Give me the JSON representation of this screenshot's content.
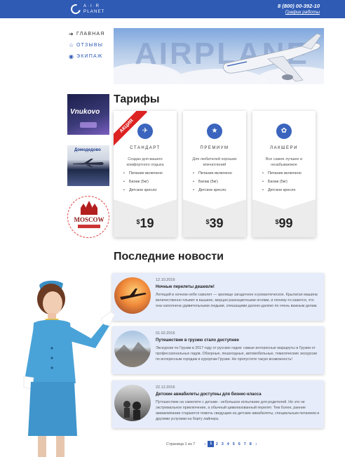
{
  "header": {
    "logo_line1": "A·I·R",
    "logo_line2": "PLANET",
    "phone": "8 (800) 00-392-10",
    "hours": "График работы"
  },
  "nav": [
    {
      "label": "ГЛАВНАЯ",
      "icon": "arrow-right-icon",
      "active": true
    },
    {
      "label": "ОТЗЫВЫ",
      "icon": "star-outline-icon",
      "active": false
    },
    {
      "label": "ЭКИПАЖ",
      "icon": "eye-icon",
      "active": false
    }
  ],
  "hero": {
    "text": "AIRPLANE"
  },
  "ads": {
    "vnukovo": "Vnukovo",
    "domodedovo": "Домодедово",
    "moscow": "MOSCOW"
  },
  "tariffs": {
    "title": "Тарифы",
    "ribbon": "АКЦИЯ",
    "items": [
      {
        "name": "СТАНДАРТ",
        "desc": "Создан для вашего комфортного отдыха",
        "features": [
          "Питание включено",
          "Багаж (5кг)",
          "Детское кресло"
        ],
        "price": "19",
        "currency": "$",
        "icon": "plane-icon"
      },
      {
        "name": "ПРЕМИУМ",
        "desc": "Для любителей хороших впечатлений",
        "features": [
          "Питание включено",
          "Багаж (5кг)",
          "Детское кресло"
        ],
        "price": "39",
        "currency": "$",
        "icon": "star-icon"
      },
      {
        "name": "ЛАКШЕРИ",
        "desc": "Все самое лучшее и незабываемое",
        "features": [
          "Питание включено",
          "Багаж (5кг)",
          "Детское кресло"
        ],
        "price": "99",
        "currency": "$",
        "icon": "palette-icon"
      }
    ]
  },
  "news": {
    "title": "Последние новости",
    "items": [
      {
        "date": "12.10.2016",
        "title": "Ночные перелеты дешевле!",
        "text": "Летящий в ночном небе самолет — зрелище загадочное и романтическое. Крылатая машина величественно плывет в вышине, мерцая разноцветными огнями, и почему-то кажется, что она наполнена удивительными людьми, спешащими далеко-далеко по очень важным делам."
      },
      {
        "date": "01.02.2016",
        "title": "Путешествие в грузию стало доступнее",
        "text": "Экскурсии по Грузии в 2017 году от русских гидов: самые интересные маршруты в Грузии от профессиональных гидов. Обзорные, пешеходные, автомобильные, тематические экскурсии по интересным городам и курортам Грузии. Не пропустите такую возможность!"
      },
      {
        "date": "22.12.2016",
        "title": "Детские авиабилеты доступны для бизнес-класса",
        "text": "Путешествие на самолете с детьми - небольшое испытание для родителей. Но это не экстремальное приключение, а обычный цивилизованный перелет. Тем более, ранние авиакомпании стараются помочь сведущим на детские авиабилеты, специальным питанием и другими услугами на борту лайнера."
      }
    ]
  },
  "pagination": {
    "label": "Страница 1 из 7",
    "prev": "‹",
    "next": "›",
    "pages": [
      "1",
      "2",
      "3",
      "4",
      "5",
      "6",
      "7",
      "8"
    ],
    "current": "1"
  },
  "colors": {
    "brand": "#2f5bb5",
    "accent": "#3a64bd",
    "ribbon": "#d22222",
    "news_bg": "#e6ecfa"
  }
}
